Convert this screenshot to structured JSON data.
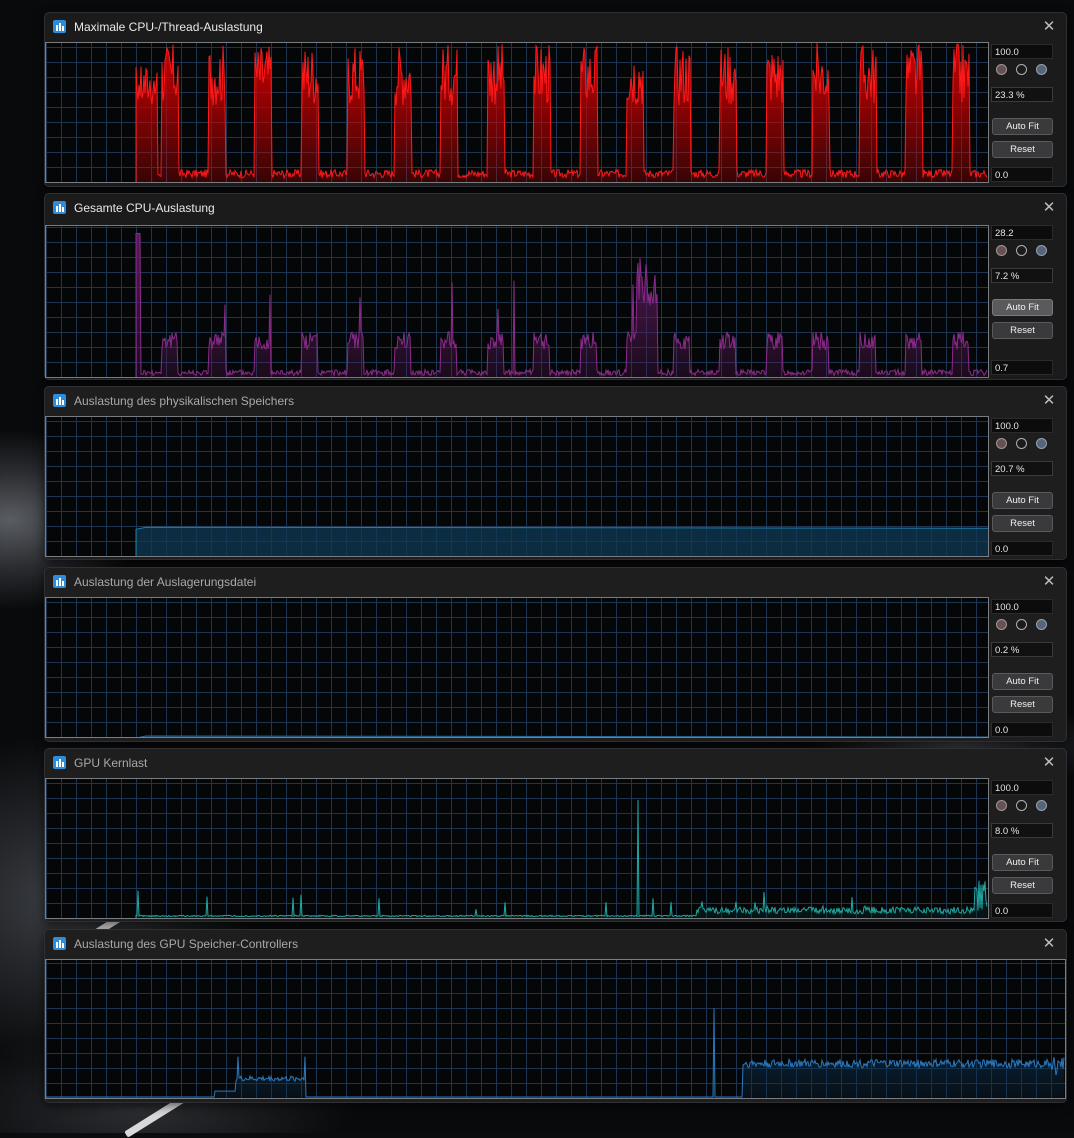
{
  "windows": [
    {
      "title": "Maximale CPU-/Thread-Auslastung",
      "max_value": "100.0",
      "current_value": "23.3 %",
      "min_value": "0.0",
      "autofit_label": "Auto Fit",
      "reset_label": "Reset",
      "line_color": "#ff1a1a",
      "fill_color": "#d00000",
      "graph": {
        "style": "cpu-thread",
        "level_percent": 23.3
      }
    },
    {
      "title": "Gesamte CPU-Auslastung",
      "max_value": "28.2",
      "current_value": "7.2 %",
      "min_value": "0.7",
      "autofit_label": "Auto Fit",
      "reset_label": "Reset",
      "line_color": "#8a2b8a",
      "fill_color": "#5a1a5a",
      "graph": {
        "style": "cpu-total",
        "level_percent": 7.2
      }
    },
    {
      "title": "Auslastung des physikalischen Speichers",
      "max_value": "100.0",
      "current_value": "20.7 %",
      "min_value": "0.0",
      "autofit_label": "Auto Fit",
      "reset_label": "Reset",
      "line_color": "#1f7fa8",
      "fill_color": "#0f3a55",
      "graph": {
        "style": "flat",
        "level_percent": 20.7
      }
    },
    {
      "title": "Auslastung der Auslagerungsdatei",
      "max_value": "100.0",
      "current_value": "0.2 %",
      "min_value": "0.0",
      "autofit_label": "Auto Fit",
      "reset_label": "Reset",
      "line_color": "#2a6ea0",
      "fill_color": "#0a2030",
      "graph": {
        "style": "flat",
        "level_percent": 0.2
      }
    },
    {
      "title": "GPU Kernlast",
      "max_value": "100.0",
      "current_value": "8.0 %",
      "min_value": "0.0",
      "autofit_label": "Auto Fit",
      "reset_label": "Reset",
      "line_color": "#1fa8a0",
      "fill_color": "#0a3a38",
      "graph": {
        "style": "gpu",
        "level_percent": 8.0
      }
    },
    {
      "title": "Auslastung des GPU Speicher-Controllers",
      "line_color": "#2a7ac0",
      "fill_color": "#0c2e4a",
      "graph": {
        "style": "gpu-mem"
      }
    }
  ]
}
